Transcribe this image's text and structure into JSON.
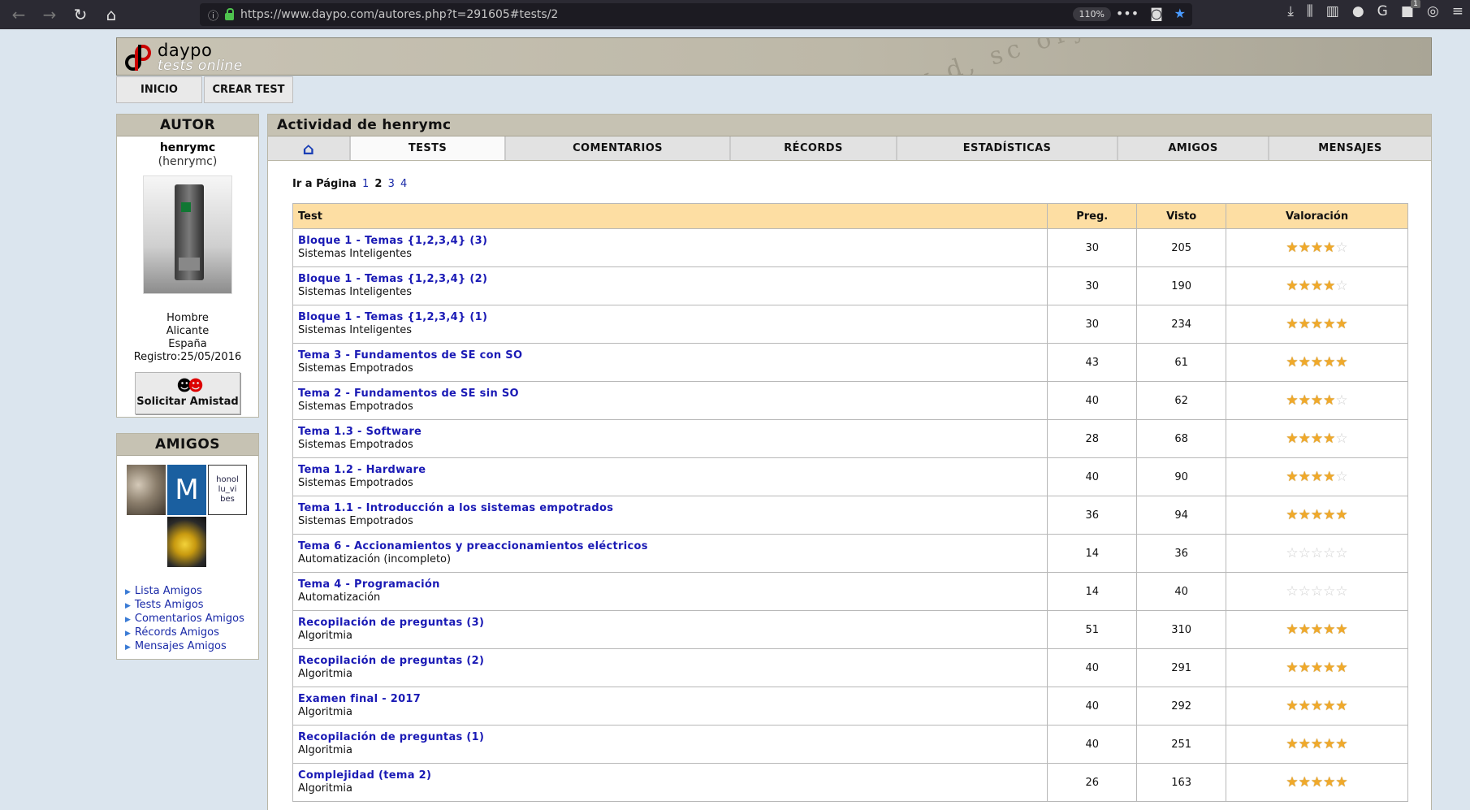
{
  "browser": {
    "url": "https://www.daypo.com/autores.php?t=291605#tests/2",
    "zoom": "110%"
  },
  "site": {
    "logo": "daypo",
    "tagline": "tests online",
    "menu": [
      "INICIO",
      "CREAR TEST"
    ]
  },
  "author": {
    "panel_title": "AUTOR",
    "name": "henrymc",
    "username": "(henrymc)",
    "gender": "Hombre",
    "city": "Alicante",
    "country": "España",
    "registered": "Registro:25/05/2016",
    "friend_button": "Solicitar Amistad"
  },
  "friends": {
    "panel_title": "AMIGOS",
    "thumb_m": "M",
    "thumb_text": [
      "honol",
      "lu_vi",
      "bes"
    ],
    "links": [
      "Lista Amigos",
      "Tests Amigos",
      "Comentarios Amigos",
      "Récords Amigos",
      "Mensajes Amigos"
    ]
  },
  "main": {
    "title": "Actividad de henrymc",
    "tabs": [
      "TESTS",
      "COMENTARIOS",
      "RÉCORDS",
      "ESTADÍSTICAS",
      "AMIGOS",
      "MENSAJES"
    ],
    "pager_label": "Ir a Página",
    "pages": [
      "1",
      "2",
      "3",
      "4"
    ],
    "current_page": "2",
    "columns": [
      "Test",
      "Preg.",
      "Visto",
      "Valoración"
    ],
    "rows": [
      {
        "title": "Bloque 1 - Temas {1,2,3,4} (3)",
        "subject": "Sistemas Inteligentes",
        "preg": "30",
        "visto": "205",
        "stars": 4
      },
      {
        "title": "Bloque 1 - Temas {1,2,3,4} (2)",
        "subject": "Sistemas Inteligentes",
        "preg": "30",
        "visto": "190",
        "stars": 4
      },
      {
        "title": "Bloque 1 - Temas {1,2,3,4} (1)",
        "subject": "Sistemas Inteligentes",
        "preg": "30",
        "visto": "234",
        "stars": 5
      },
      {
        "title": "Tema 3 - Fundamentos de SE con SO",
        "subject": "Sistemas Empotrados",
        "preg": "43",
        "visto": "61",
        "stars": 5
      },
      {
        "title": "Tema 2 - Fundamentos de SE sin SO",
        "subject": "Sistemas Empotrados",
        "preg": "40",
        "visto": "62",
        "stars": 4
      },
      {
        "title": "Tema 1.3 - Software",
        "subject": "Sistemas Empotrados",
        "preg": "28",
        "visto": "68",
        "stars": 4
      },
      {
        "title": "Tema 1.2 - Hardware",
        "subject": "Sistemas Empotrados",
        "preg": "40",
        "visto": "90",
        "stars": 4
      },
      {
        "title": "Tema 1.1 - Introducción a los sistemas empotrados",
        "subject": "Sistemas Empotrados",
        "preg": "36",
        "visto": "94",
        "stars": 5
      },
      {
        "title": "Tema 6 - Accionamientos y preaccionamientos eléctricos",
        "subject": "Automatización (incompleto)",
        "preg": "14",
        "visto": "36",
        "stars": 0
      },
      {
        "title": "Tema 4 - Programación",
        "subject": "Automatización",
        "preg": "14",
        "visto": "40",
        "stars": 0
      },
      {
        "title": "Recopilación de preguntas (3)",
        "subject": "Algoritmia",
        "preg": "51",
        "visto": "310",
        "stars": 5
      },
      {
        "title": "Recopilación de preguntas (2)",
        "subject": "Algoritmia",
        "preg": "40",
        "visto": "291",
        "stars": 5
      },
      {
        "title": "Examen final - 2017",
        "subject": "Algoritmia",
        "preg": "40",
        "visto": "292",
        "stars": 5
      },
      {
        "title": "Recopilación de preguntas (1)",
        "subject": "Algoritmia",
        "preg": "40",
        "visto": "251",
        "stars": 5
      },
      {
        "title": "Complejidad (tema 2)",
        "subject": "Algoritmia",
        "preg": "26",
        "visto": "163",
        "stars": 5
      }
    ]
  }
}
